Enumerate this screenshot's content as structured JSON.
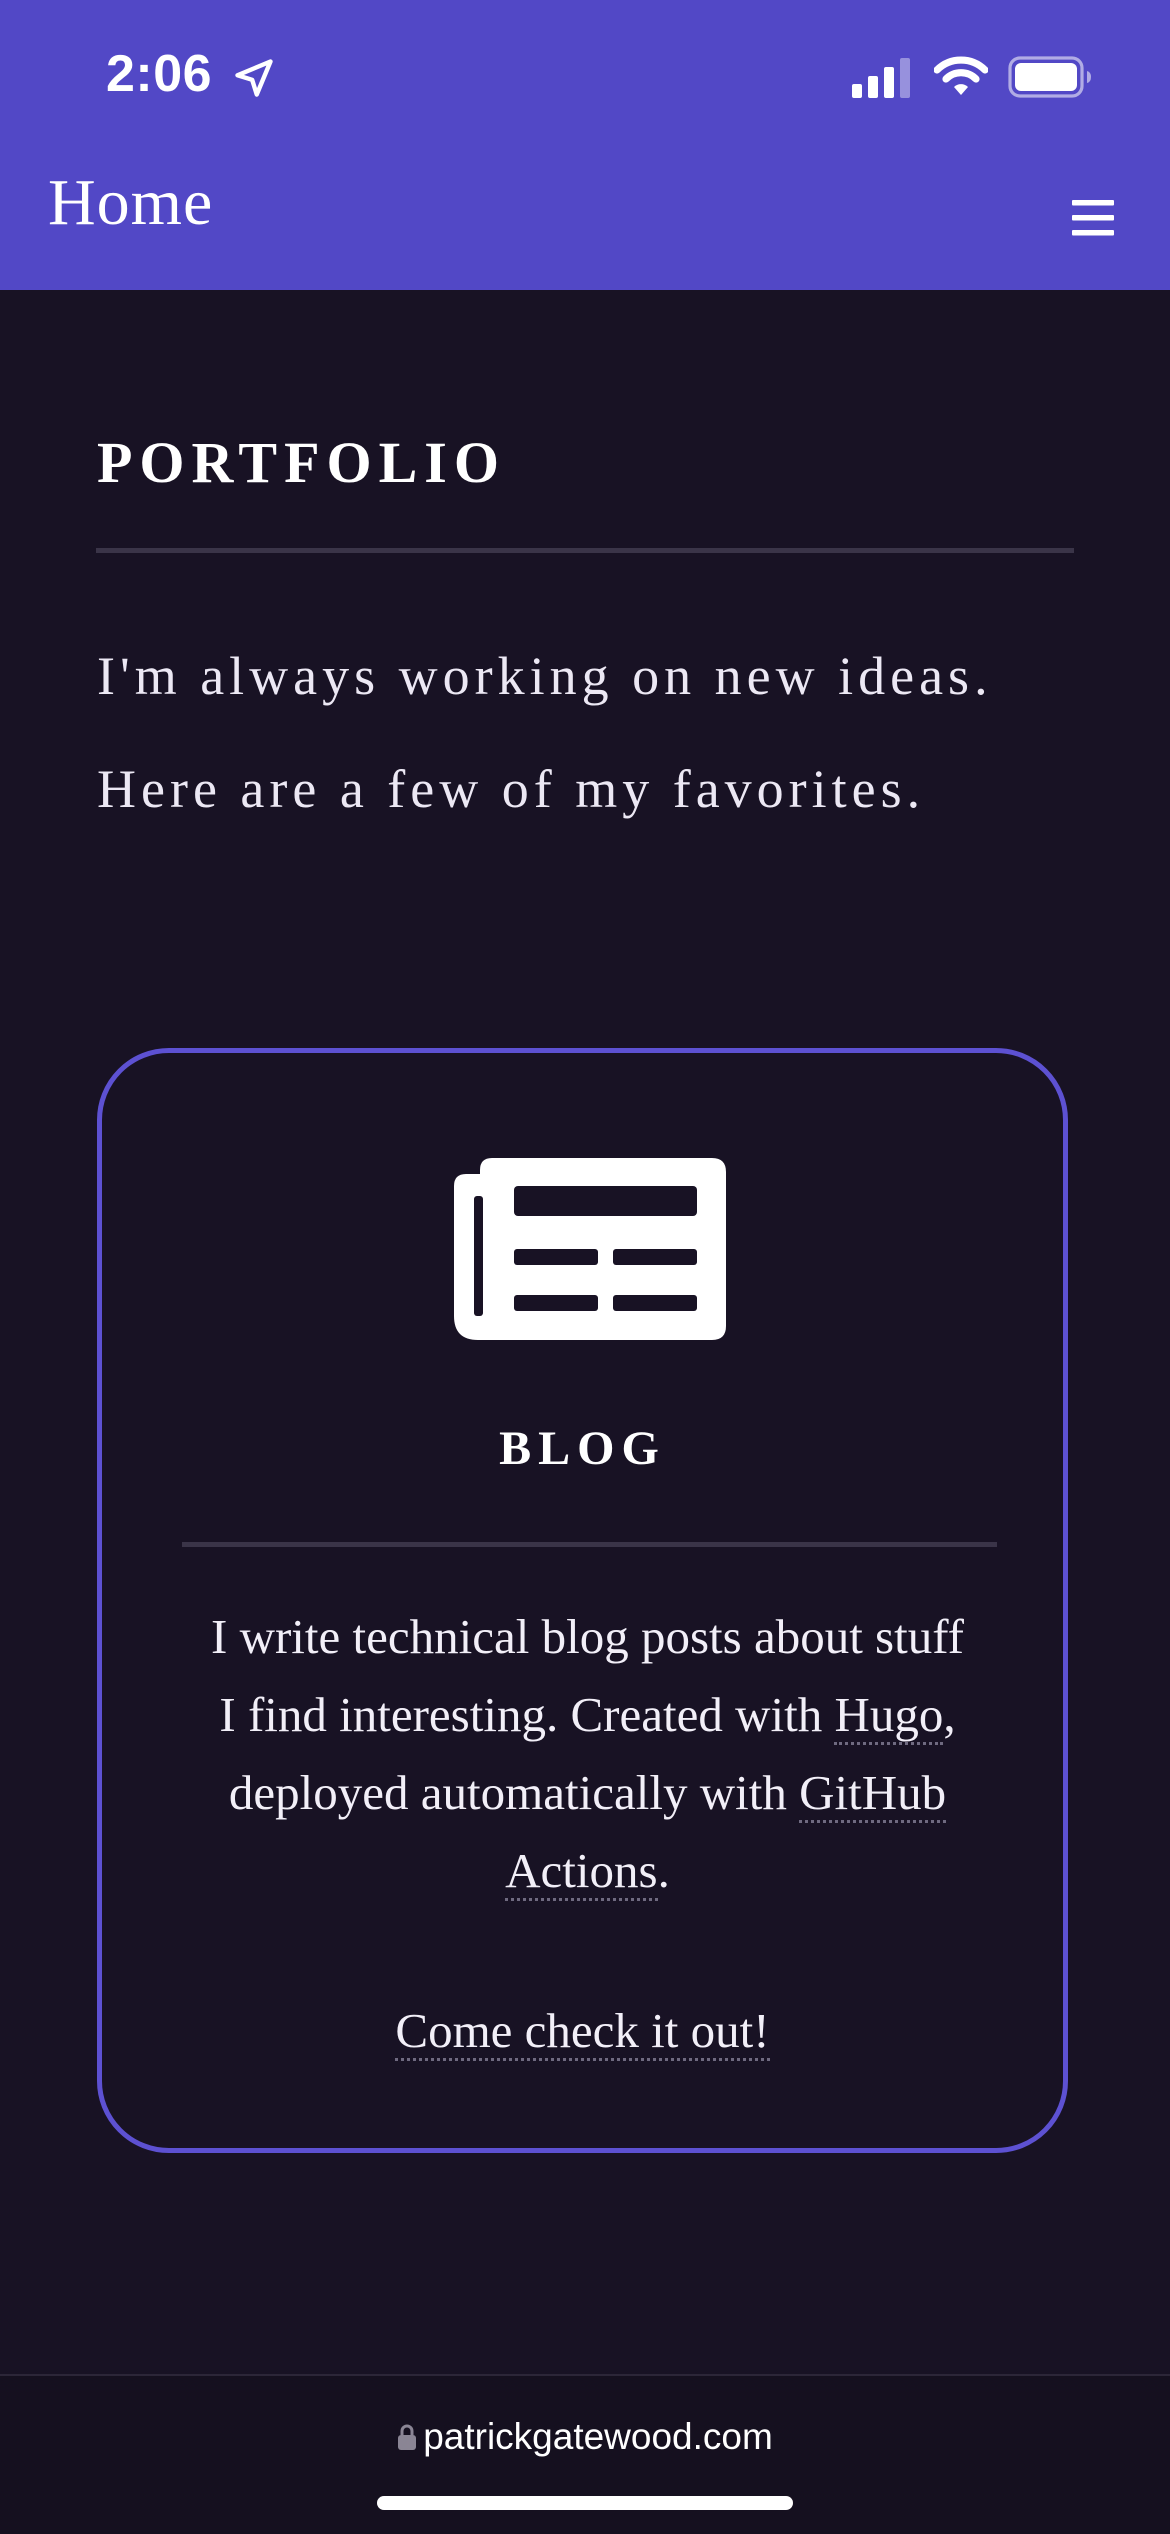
{
  "status_bar": {
    "time": "2:06",
    "icons": [
      "location-arrow-icon",
      "cellular-signal-icon",
      "wifi-icon",
      "battery-icon"
    ]
  },
  "nav": {
    "title": "Home",
    "menu_icon": "hamburger-menu-icon"
  },
  "page": {
    "section_title": "PORTFOLIO",
    "intro_lines": [
      "I'm always working on new ideas.",
      "Here are a few of my favorites."
    ]
  },
  "card": {
    "icon": "newspaper-icon",
    "title": "BLOG",
    "desc_line1": "I write technical blog posts about stuff",
    "desc_line2_pre": "I find interesting. Created with ",
    "hugo_link": "Hugo",
    "desc_line2_post": ",",
    "desc_line3_pre": "deployed automatically with ",
    "github_link": "GitHub",
    "actions_link": "Actions",
    "desc_line4_post": ".",
    "cta_link": "Come check it out!"
  },
  "browser": {
    "url": "patrickgatewood.com",
    "lock_icon": "lock-icon"
  },
  "colors": {
    "header_bg": "#5248c6",
    "page_bg": "#181224",
    "card_border": "#5d51d2",
    "rule": "#3a3448"
  }
}
